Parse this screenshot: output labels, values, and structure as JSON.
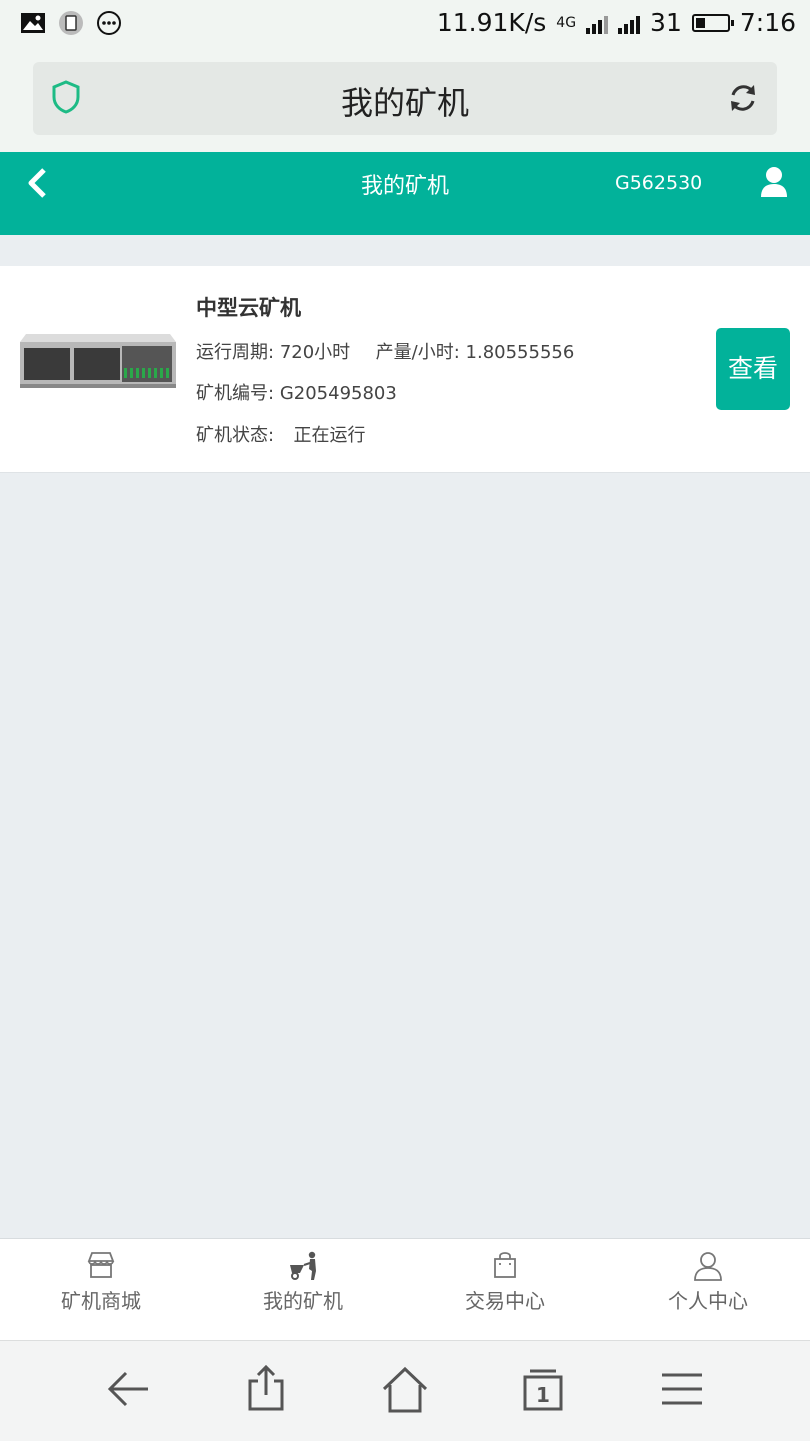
{
  "status_bar": {
    "speed": "11.91K/s",
    "network": "4G",
    "battery": "31",
    "time": "7:16"
  },
  "browser": {
    "title": "我的矿机"
  },
  "header": {
    "title": "我的矿机",
    "user_id": "G562530"
  },
  "machine": {
    "name": "中型云矿机",
    "cycle_label": "运行周期:",
    "cycle_value": "720小时",
    "output_label": "产量/小时:",
    "output_value": "1.80555556",
    "number_label": "矿机编号:",
    "number_value": "G205495803",
    "status_label": "矿机状态:",
    "status_value": "正在运行",
    "view_button": "查看"
  },
  "tabs": [
    {
      "label": "矿机商城",
      "icon": "store-icon"
    },
    {
      "label": "我的矿机",
      "icon": "miner-icon"
    },
    {
      "label": "交易中心",
      "icon": "bag-icon"
    },
    {
      "label": "个人中心",
      "icon": "person-icon"
    }
  ],
  "colors": {
    "accent": "#02b29a",
    "background": "#eaeef1"
  }
}
